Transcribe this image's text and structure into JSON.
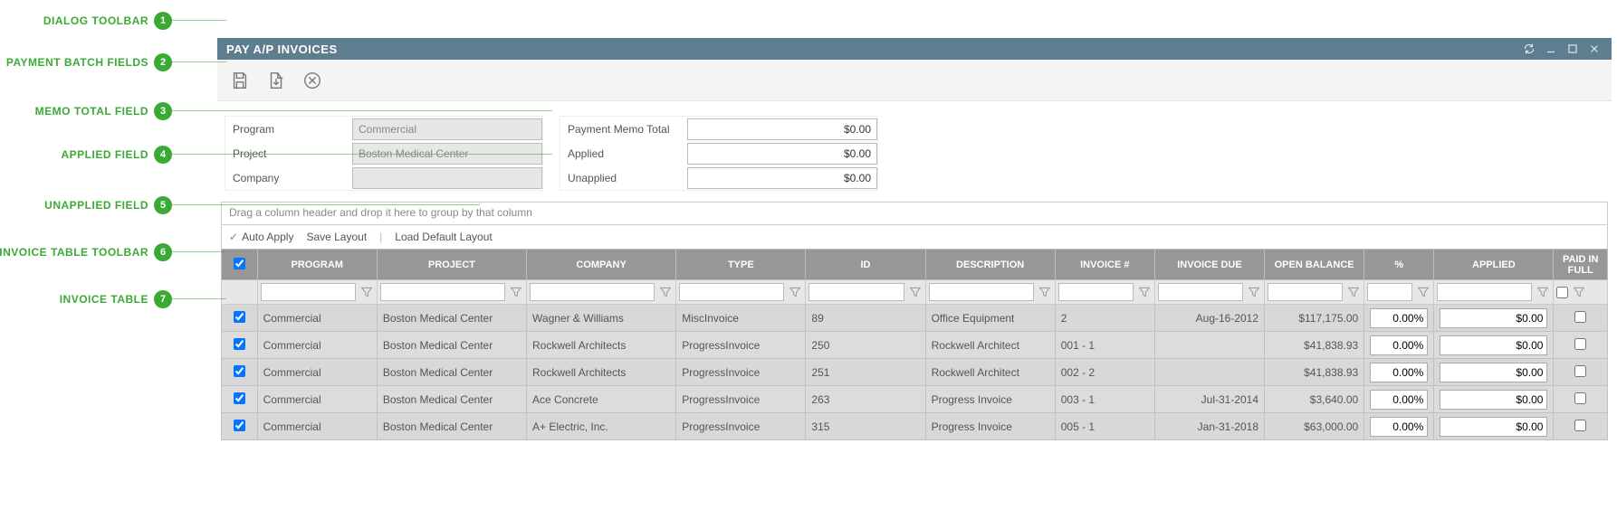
{
  "callouts": [
    {
      "label": "DIALOG TOOLBAR",
      "num": "1"
    },
    {
      "label": "PAYMENT BATCH FIELDS",
      "num": "2"
    },
    {
      "label": "MEMO TOTAL FIELD",
      "num": "3"
    },
    {
      "label": "APPLIED FIELD",
      "num": "4"
    },
    {
      "label": "UNAPPLIED FIELD",
      "num": "5"
    },
    {
      "label": "INVOICE TABLE TOOLBAR",
      "num": "6"
    },
    {
      "label": "INVOICE TABLE",
      "num": "7"
    }
  ],
  "titlebar": {
    "title": "PAY A/P INVOICES"
  },
  "fields": {
    "left": {
      "program_label": "Program",
      "program_value": "Commercial",
      "project_label": "Project",
      "project_value": "Boston Medical Center",
      "company_label": "Company",
      "company_value": ""
    },
    "right": {
      "memo_label": "Payment Memo Total",
      "memo_value": "$0.00",
      "applied_label": "Applied",
      "applied_value": "$0.00",
      "unapplied_label": "Unapplied",
      "unapplied_value": "$0.00"
    }
  },
  "grid": {
    "group_drop_text": "Drag a column header and drop it here to group by that column",
    "toolbar": {
      "auto_apply": "Auto Apply",
      "save_layout": "Save Layout",
      "load_default": "Load Default Layout"
    },
    "columns": {
      "program": "PROGRAM",
      "project": "PROJECT",
      "company": "COMPANY",
      "type": "TYPE",
      "id": "ID",
      "description": "DESCRIPTION",
      "invoice_no": "INVOICE #",
      "invoice_due": "INVOICE DUE",
      "open_balance": "OPEN BALANCE",
      "percent": "%",
      "applied": "APPLIED",
      "paid_in_full": "PAID IN FULL"
    },
    "rows": [
      {
        "checked": true,
        "program": "Commercial",
        "project": "Boston Medical Center",
        "company": "Wagner & Williams",
        "type": "MiscInvoice",
        "id": "89",
        "description": "Office Equipment",
        "invoice_no": "2",
        "invoice_due": "Aug-16-2012",
        "open_balance": "$117,175.00",
        "percent": "0.00%",
        "applied": "$0.00",
        "paid": false
      },
      {
        "checked": true,
        "program": "Commercial",
        "project": "Boston Medical Center",
        "company": "Rockwell Architects",
        "type": "ProgressInvoice",
        "id": "250",
        "description": "Rockwell Architect",
        "invoice_no": "001 - 1",
        "invoice_due": "",
        "open_balance": "$41,838.93",
        "percent": "0.00%",
        "applied": "$0.00",
        "paid": false
      },
      {
        "checked": true,
        "program": "Commercial",
        "project": "Boston Medical Center",
        "company": "Rockwell Architects",
        "type": "ProgressInvoice",
        "id": "251",
        "description": "Rockwell Architect",
        "invoice_no": "002 - 2",
        "invoice_due": "",
        "open_balance": "$41,838.93",
        "percent": "0.00%",
        "applied": "$0.00",
        "paid": false
      },
      {
        "checked": true,
        "program": "Commercial",
        "project": "Boston Medical Center",
        "company": "Ace Concrete",
        "type": "ProgressInvoice",
        "id": "263",
        "description": "Progress Invoice",
        "invoice_no": "003 - 1",
        "invoice_due": "Jul-31-2014",
        "open_balance": "$3,640.00",
        "percent": "0.00%",
        "applied": "$0.00",
        "paid": false
      },
      {
        "checked": true,
        "program": "Commercial",
        "project": "Boston Medical Center",
        "company": "A+ Electric, Inc.",
        "type": "ProgressInvoice",
        "id": "315",
        "description": "Progress Invoice",
        "invoice_no": "005 - 1",
        "invoice_due": "Jan-31-2018",
        "open_balance": "$63,000.00",
        "percent": "0.00%",
        "applied": "$0.00",
        "paid": false
      }
    ]
  }
}
